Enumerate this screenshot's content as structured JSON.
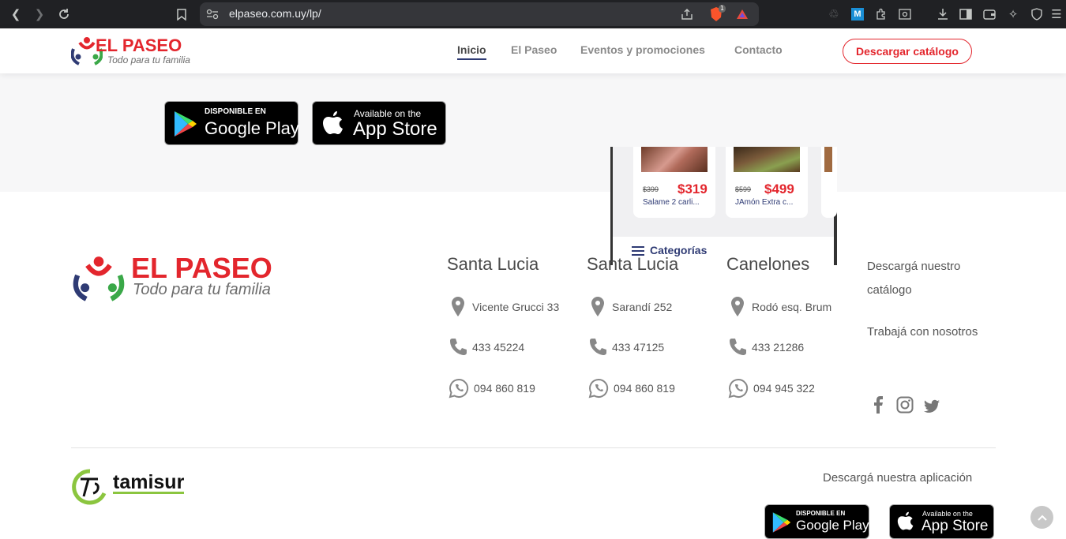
{
  "browser": {
    "url": "elpaseo.com.uy/lp/",
    "brave_badge": "1"
  },
  "header": {
    "logo_title": "EL PASEO",
    "logo_tagline": "Todo para tu familia",
    "nav": [
      {
        "label": "Inicio",
        "active": true
      },
      {
        "label": "El Paseo"
      },
      {
        "label": "Eventos y promociones"
      },
      {
        "label": "Contacto"
      }
    ],
    "catalog_button": "Descargar catálogo"
  },
  "hero": {
    "google_play": {
      "small": "DISPONIBLE EN",
      "big": "Google Play"
    },
    "app_store": {
      "small": "Available on the",
      "big": "App Store"
    },
    "phone": {
      "products": [
        {
          "old_price": "$399",
          "new_price": "$319",
          "name": "Salame 2 carli..."
        },
        {
          "old_price": "$599",
          "new_price": "$499",
          "name": "JAmón Extra c..."
        }
      ],
      "categories_label": "Categorías"
    }
  },
  "footer": {
    "logo_title": "EL PASEO",
    "logo_tagline": "Todo para tu familia",
    "stores": [
      {
        "city": "Santa Lucia",
        "address": "Vicente Grucci 33",
        "phone": "433 45224",
        "whatsapp": "094 860 819"
      },
      {
        "city": "Santa Lucia",
        "address": "Sarandí 252",
        "phone": "433 47125",
        "whatsapp": "094 860 819"
      },
      {
        "city": "Canelones",
        "address": "Rodó esq. Brum",
        "phone": "433 21286",
        "whatsapp": "094 945 322"
      }
    ],
    "links": {
      "catalog_line1": "Descargá nuestro",
      "catalog_line2": "catálogo",
      "work": "Trabajá con nosotros"
    },
    "social": [
      "facebook-icon",
      "instagram-icon",
      "twitter-icon"
    ],
    "credit": "tamisur",
    "app_heading": "Descargá nuestra aplicación",
    "google_play": {
      "small": "DISPONIBLE EN",
      "big": "Google Play"
    },
    "app_store": {
      "small": "Available on the",
      "big": "App Store"
    }
  },
  "colors": {
    "brand_red": "#e3262d",
    "brand_navy": "#2f3b74",
    "brand_green": "#3aa848"
  }
}
